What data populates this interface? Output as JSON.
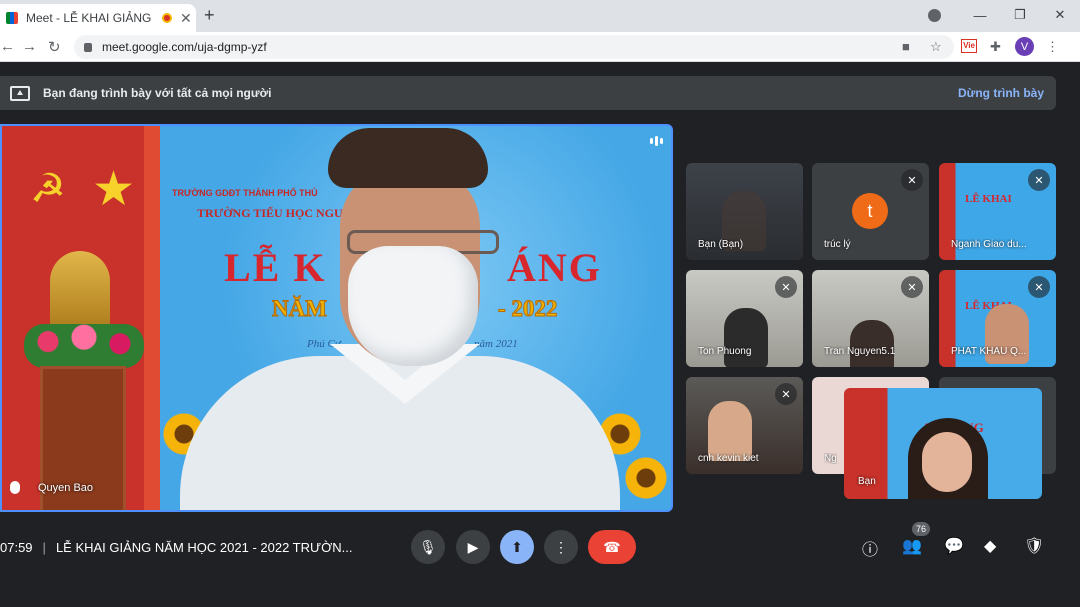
{
  "browser": {
    "tab_title": "Meet - LỄ KHAI GIẢNG NĂM",
    "url": "meet.google.com/uja-dgmp-yzf",
    "profile_initial": "V",
    "ext_label": "Vie"
  },
  "banner": {
    "text": "Bạn đang trình bày với tất cả mọi người",
    "stop_label": "Dừng trình bày"
  },
  "main_video": {
    "participant": "Quyen Bao",
    "school_line1": "TRƯỜNG GDĐT THÀNH PHỐ THỦ",
    "school_line2": "TRƯỜNG TIỂU HỌC NGUYỄN",
    "title_left": "LỄ K",
    "title_right": "ÁNG",
    "year_left": "NĂM",
    "year_right": "- 2022",
    "place_left": "Phú Cư",
    "place_right": "năm 2021"
  },
  "tiles": [
    {
      "name": "Bạn (Bạn)",
      "muted": false
    },
    {
      "name": "trúc lý",
      "initial": "t",
      "muted": true
    },
    {
      "name": "Nganh Giao du...",
      "muted": true
    },
    {
      "name": "Ton Phuong",
      "muted": true
    },
    {
      "name": "Tran Nguyen5.1",
      "muted": true
    },
    {
      "name": "PHAT KHAU Q...",
      "muted": true
    },
    {
      "name": "cnh kevin kiet",
      "muted": true
    },
    {
      "name": "Ng",
      "muted": false
    }
  ],
  "self_tile": {
    "name": "Bạn",
    "title": "AI GIẢNG"
  },
  "bottom": {
    "time": "07:59",
    "meeting_title": "LỄ KHAI GIẢNG NĂM HỌC 2021 - 2022 TRƯỜN...",
    "participant_count": "76"
  },
  "colors": {
    "accent": "#8ab4f8",
    "leave": "#ea4335",
    "background": "#202124"
  }
}
